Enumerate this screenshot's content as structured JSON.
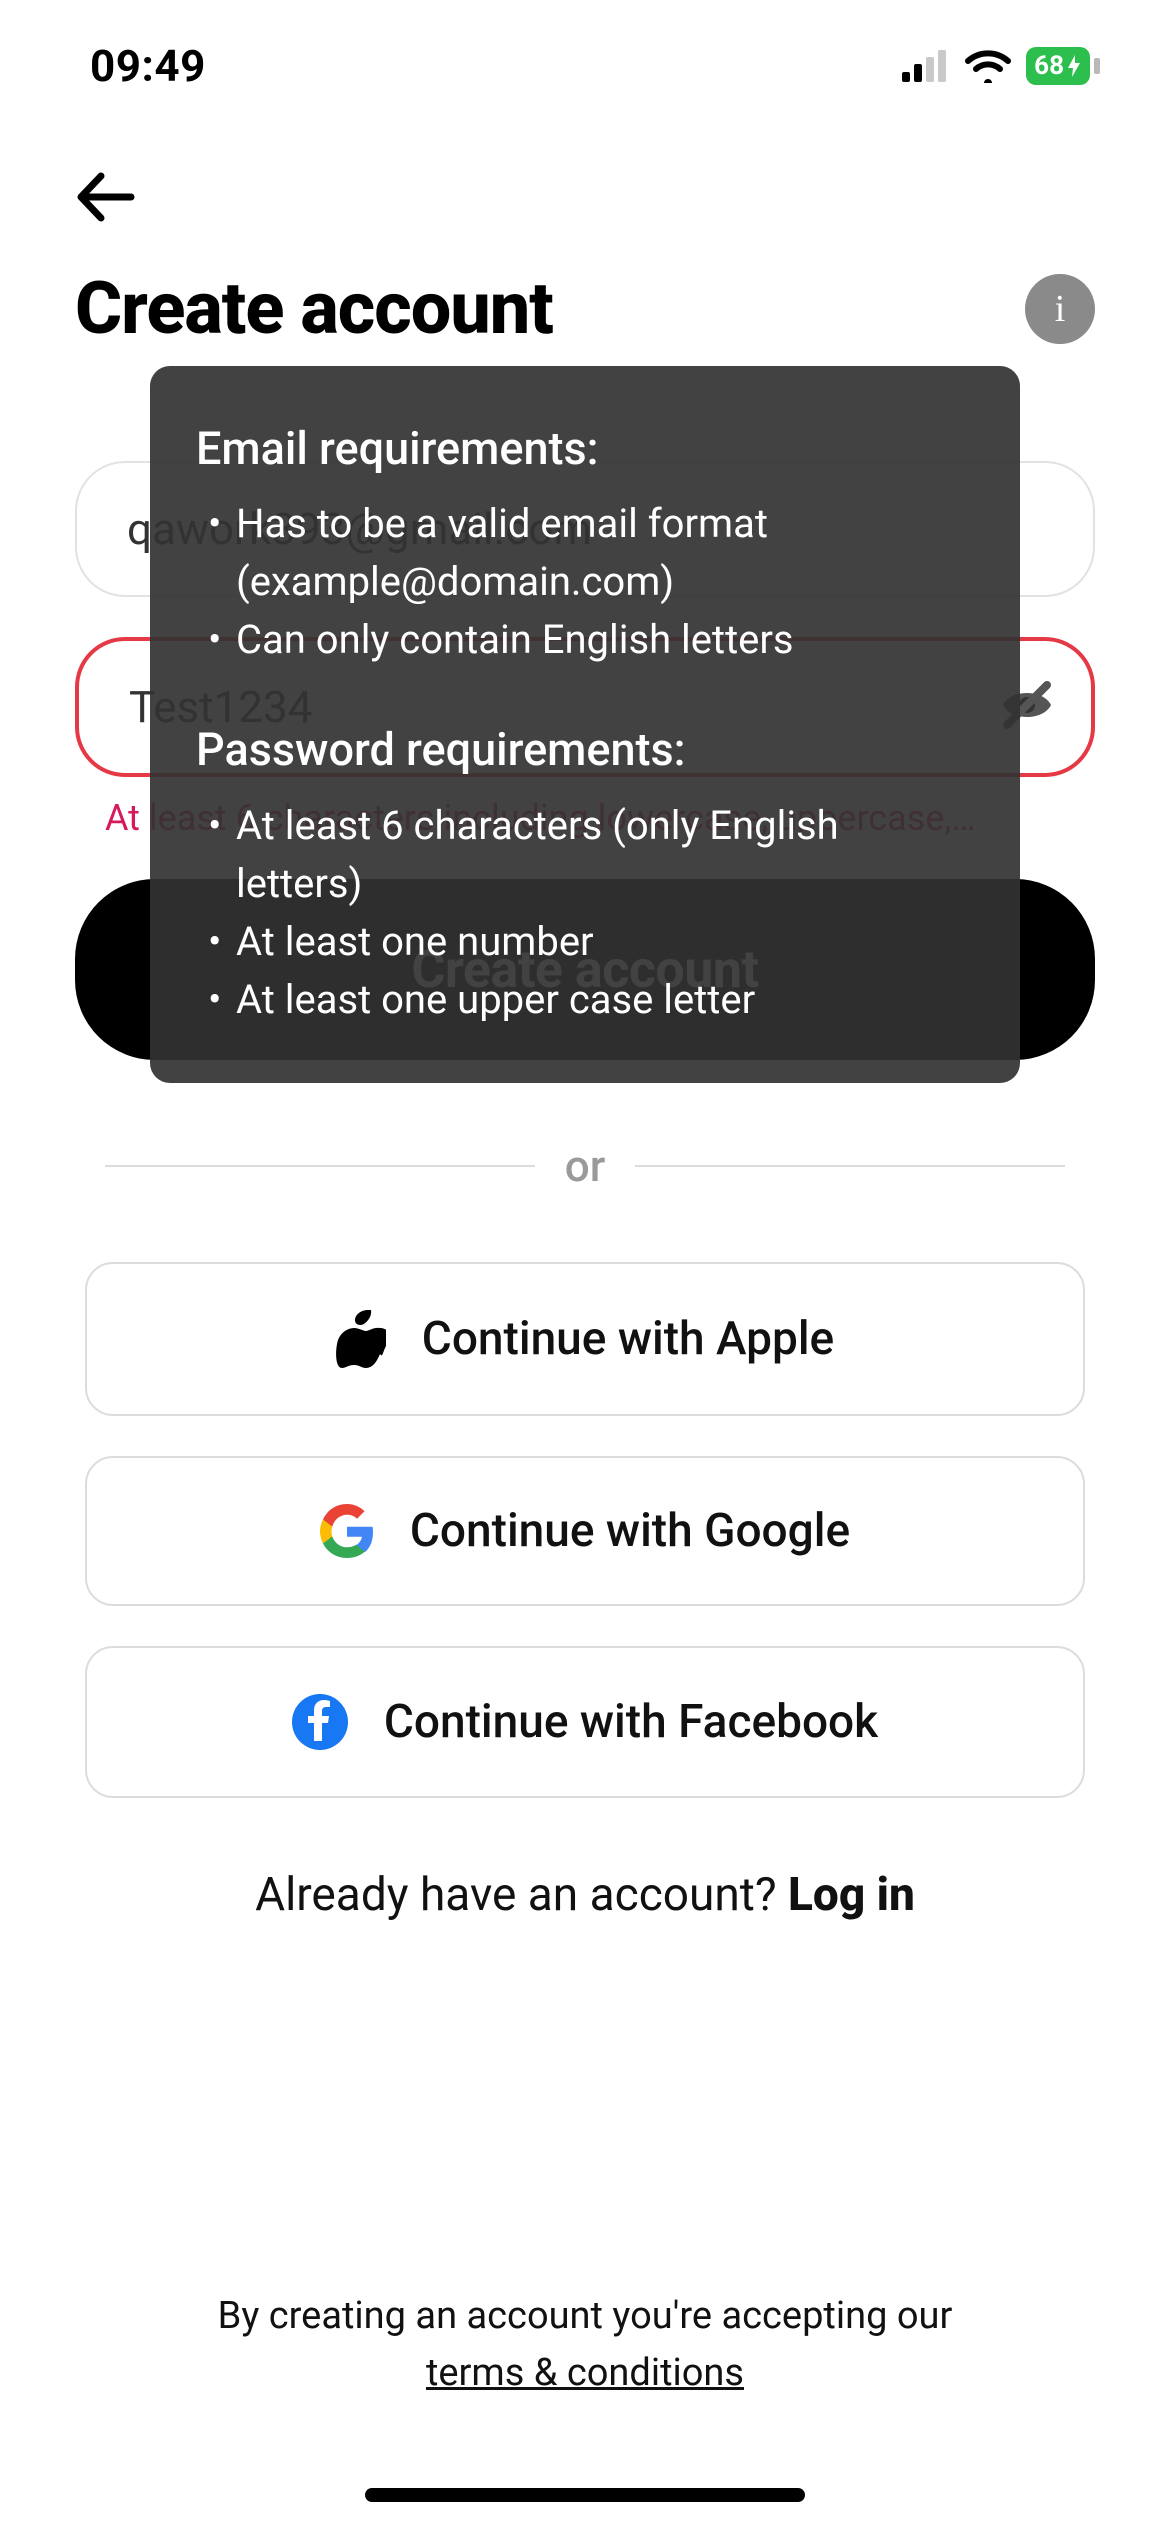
{
  "status": {
    "time": "09:49",
    "battery": "68"
  },
  "header": {
    "title": "Create account"
  },
  "form": {
    "email_value": "qawork393@gmail.com",
    "password_value": "Test1234",
    "password_hint": "At least 6 characters including lowercase, uppercase,…",
    "submit_label": "Create account"
  },
  "divider": {
    "label": "or"
  },
  "social": {
    "apple": "Continue with Apple",
    "google": "Continue with Google",
    "facebook": "Continue with Facebook"
  },
  "login": {
    "prompt": "Already have an account? ",
    "link": "Log in"
  },
  "terms": {
    "line1": "By creating an account you're accepting our",
    "link": "terms & conditions"
  },
  "tooltip": {
    "email_title": "Email requirements:",
    "email_r1": "Has to be a valid email format (example@domain.com)",
    "email_r2": "Can only contain English letters",
    "pw_title": "Password requirements:",
    "pw_r1": "At least 6 characters (only English letters)",
    "pw_r2": "At least one number",
    "pw_r3": "At least one upper case letter"
  }
}
